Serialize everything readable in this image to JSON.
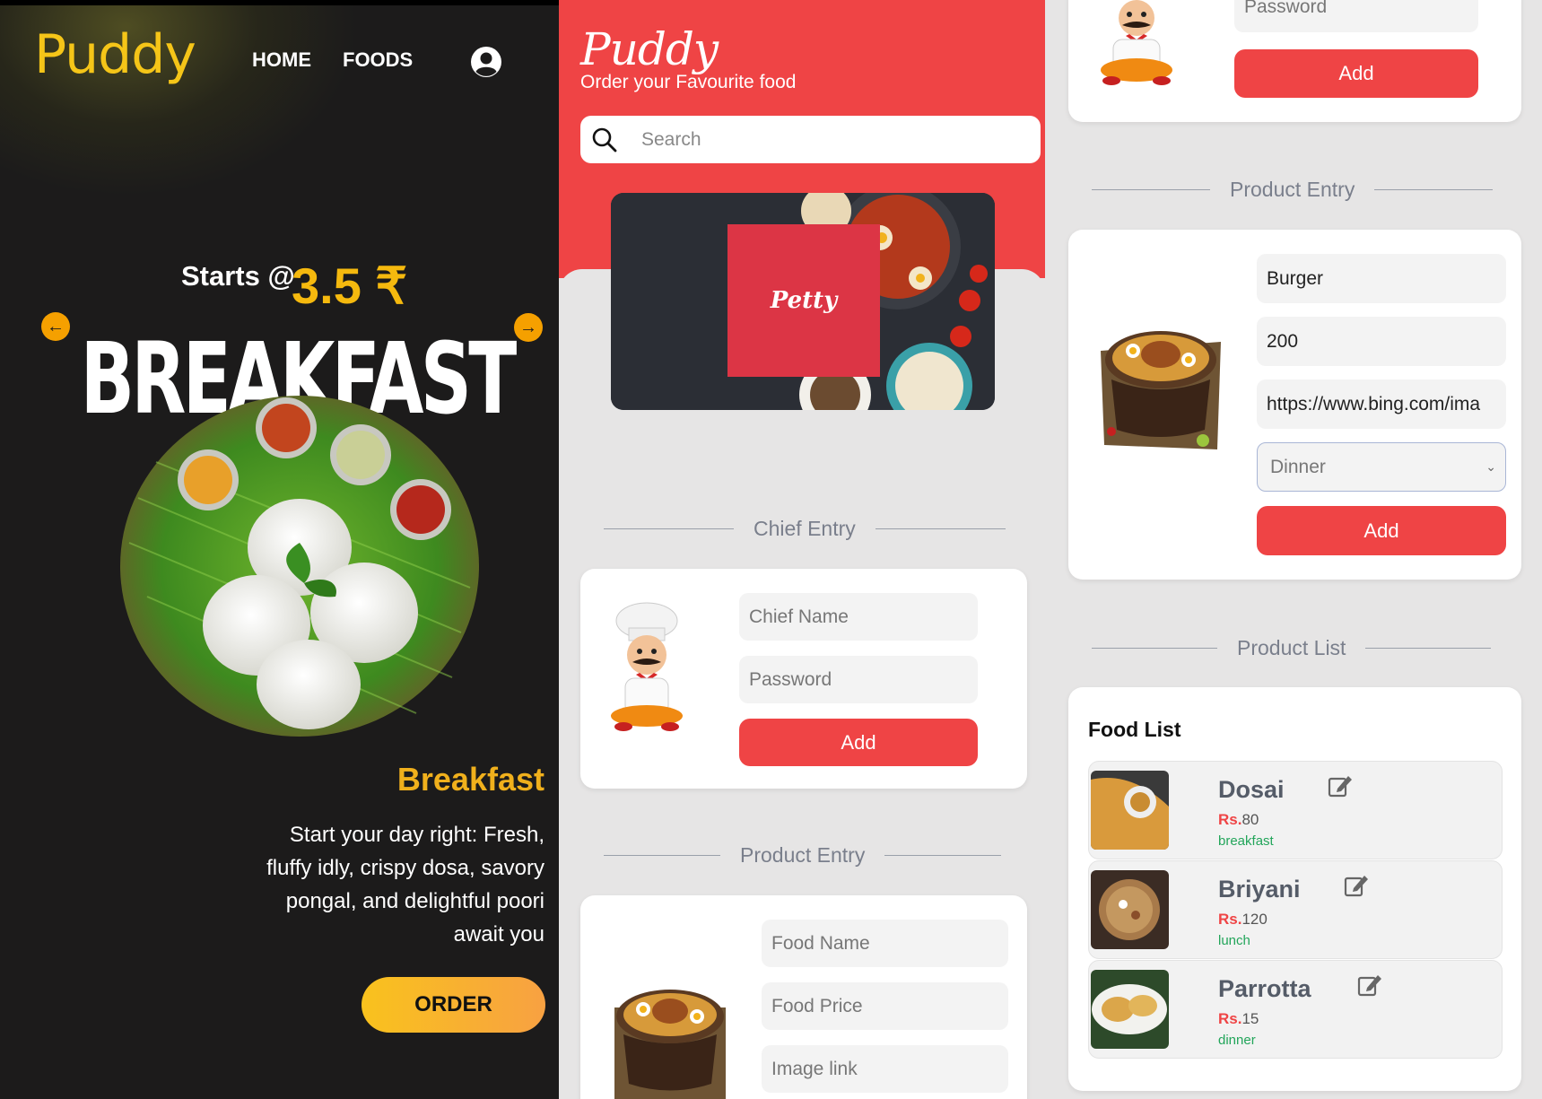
{
  "panel1": {
    "brand": "Puddy",
    "nav": {
      "home": "HOME",
      "foods": "FOODS"
    },
    "hero": {
      "starts_label": "Starts @",
      "price": "3.5 ₹",
      "big_title": "BREAKFAST",
      "heading": "Breakfast",
      "description": "Start your day right: Fresh, fluffy idly, crispy dosa, savory pongal, and delightful poori await you",
      "order_label": "ORDER"
    }
  },
  "panel2": {
    "brand": "Puddy",
    "tagline": "Order your Favourite food",
    "search_placeholder": "Search",
    "banner_label": "Petty",
    "chief_section": "Chief Entry",
    "chief_name_placeholder": "Chief Name",
    "password_placeholder": "Password",
    "add_label": "Add",
    "product_section": "Product Entry",
    "food_name_placeholder": "Food Name",
    "food_price_placeholder": "Food Price",
    "image_link_placeholder": "Image link"
  },
  "panel3": {
    "password_placeholder": "Password",
    "add_label": "Add",
    "product_section": "Product Entry",
    "product_form": {
      "name_value": "Burger",
      "price_value": "200",
      "link_value": "https://www.bing.com/ima",
      "meal_selected": "Dinner",
      "add_label": "Add"
    },
    "list_section": "Product List",
    "food_list_title": "Food List",
    "rs_label": "Rs.",
    "items": [
      {
        "name": "Dosai",
        "price": "80",
        "category": "breakfast"
      },
      {
        "name": "Briyani",
        "price": "120",
        "category": "lunch"
      },
      {
        "name": "Parrotta",
        "price": "15",
        "category": "dinner"
      }
    ]
  },
  "colors": {
    "accent_red": "#ef4445",
    "gold": "#f5b90e",
    "dark_bg": "#1c1b1b",
    "category_green": "#22a55a"
  }
}
